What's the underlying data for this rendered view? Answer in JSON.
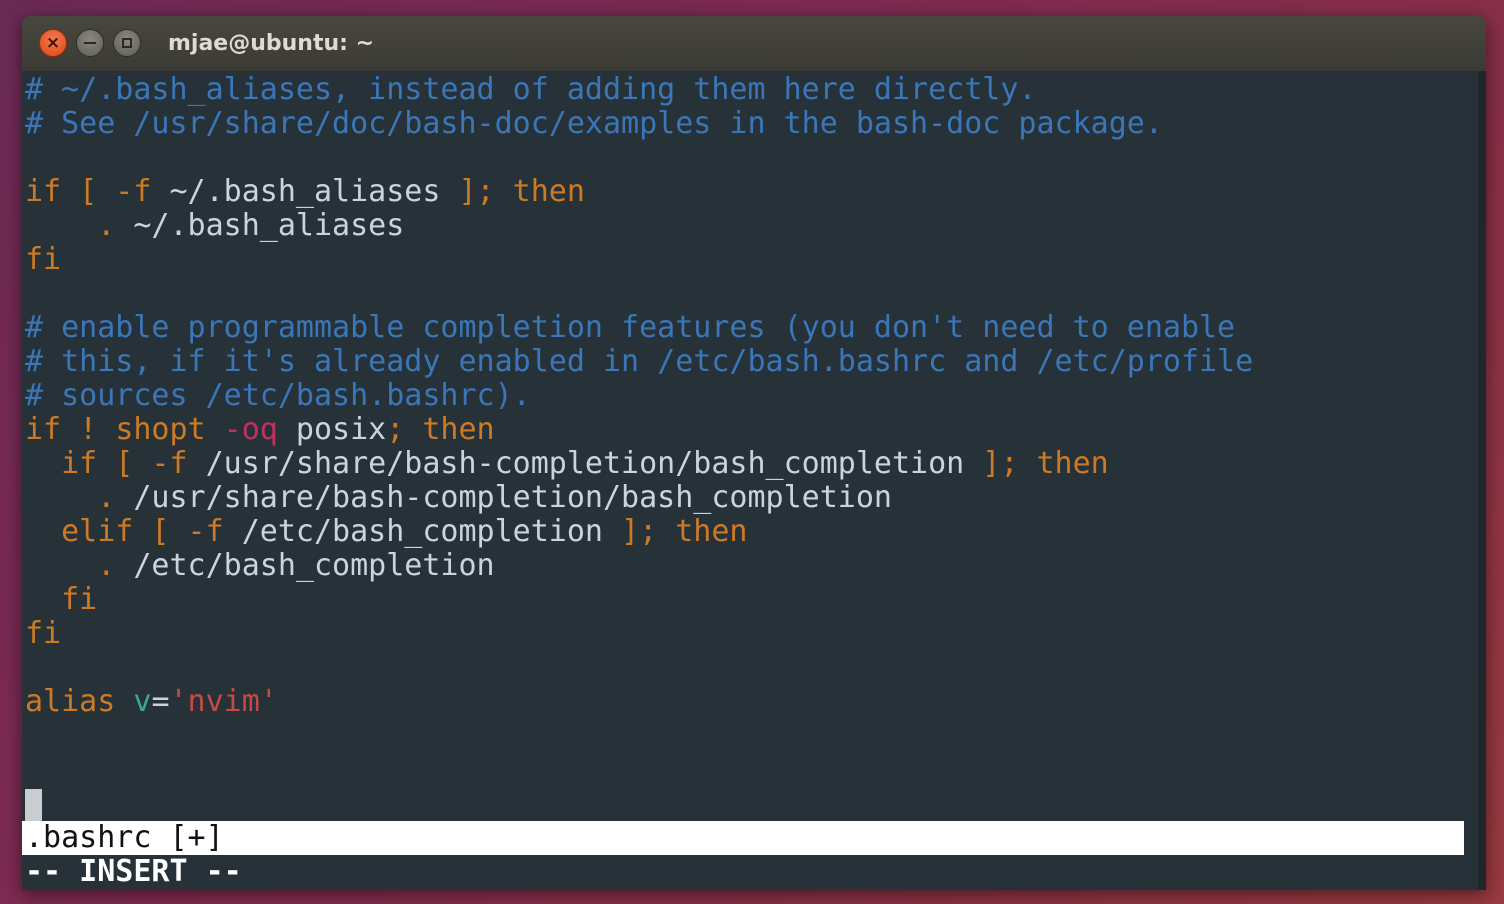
{
  "window": {
    "title": "mjae@ubuntu: ~"
  },
  "editor": {
    "lines": [
      [
        {
          "t": "# ~/.bash_aliases, instead of adding them here directly.",
          "c": "comment"
        }
      ],
      [
        {
          "t": "# See /usr/share/doc/bash-doc/examples in the bash-doc package.",
          "c": "comment"
        }
      ],
      [],
      [
        {
          "t": "if [ -f ",
          "c": "kw"
        },
        {
          "t": "~/.bash_aliases",
          "c": "default"
        },
        {
          "t": " ]; then",
          "c": "kw"
        }
      ],
      [
        {
          "t": "    . ",
          "c": "kw"
        },
        {
          "t": "~/.bash_aliases",
          "c": "default"
        }
      ],
      [
        {
          "t": "fi",
          "c": "kw"
        }
      ],
      [],
      [
        {
          "t": "# enable programmable completion features (you don't need to enable",
          "c": "comment"
        }
      ],
      [
        {
          "t": "# this, if it's already enabled in /etc/bash.bashrc and /etc/profile",
          "c": "comment"
        }
      ],
      [
        {
          "t": "# sources /etc/bash.bashrc).",
          "c": "comment"
        }
      ],
      [
        {
          "t": "if ! ",
          "c": "kw"
        },
        {
          "t": "shopt",
          "c": "kw"
        },
        {
          "t": " -oq",
          "c": "pink"
        },
        {
          "t": " posix",
          "c": "default"
        },
        {
          "t": "; then",
          "c": "kw"
        }
      ],
      [
        {
          "t": "  if [ -f ",
          "c": "kw"
        },
        {
          "t": "/usr/share/bash-completion/bash_completion",
          "c": "default"
        },
        {
          "t": " ]; then",
          "c": "kw"
        }
      ],
      [
        {
          "t": "    . ",
          "c": "kw"
        },
        {
          "t": "/usr/share/bash-completion/bash_completion",
          "c": "default"
        }
      ],
      [
        {
          "t": "  elif [ -f ",
          "c": "kw"
        },
        {
          "t": "/etc/bash_completion",
          "c": "default"
        },
        {
          "t": " ]; then",
          "c": "kw"
        }
      ],
      [
        {
          "t": "    . ",
          "c": "kw"
        },
        {
          "t": "/etc/bash_completion",
          "c": "default"
        }
      ],
      [
        {
          "t": "  fi",
          "c": "kw"
        }
      ],
      [
        {
          "t": "fi",
          "c": "kw"
        }
      ],
      [],
      [
        {
          "t": "alias ",
          "c": "kw"
        },
        {
          "t": "v",
          "c": "cyan"
        },
        {
          "t": "=",
          "c": "default"
        },
        {
          "t": "'nvim'",
          "c": "red"
        }
      ]
    ],
    "status_line": ".bashrc [+]",
    "mode_line": "-- INSERT --"
  },
  "colors": {
    "background": "#263238",
    "comment": "#3b76b8",
    "keyword": "#cc7a26",
    "text": "#cdd3de"
  }
}
